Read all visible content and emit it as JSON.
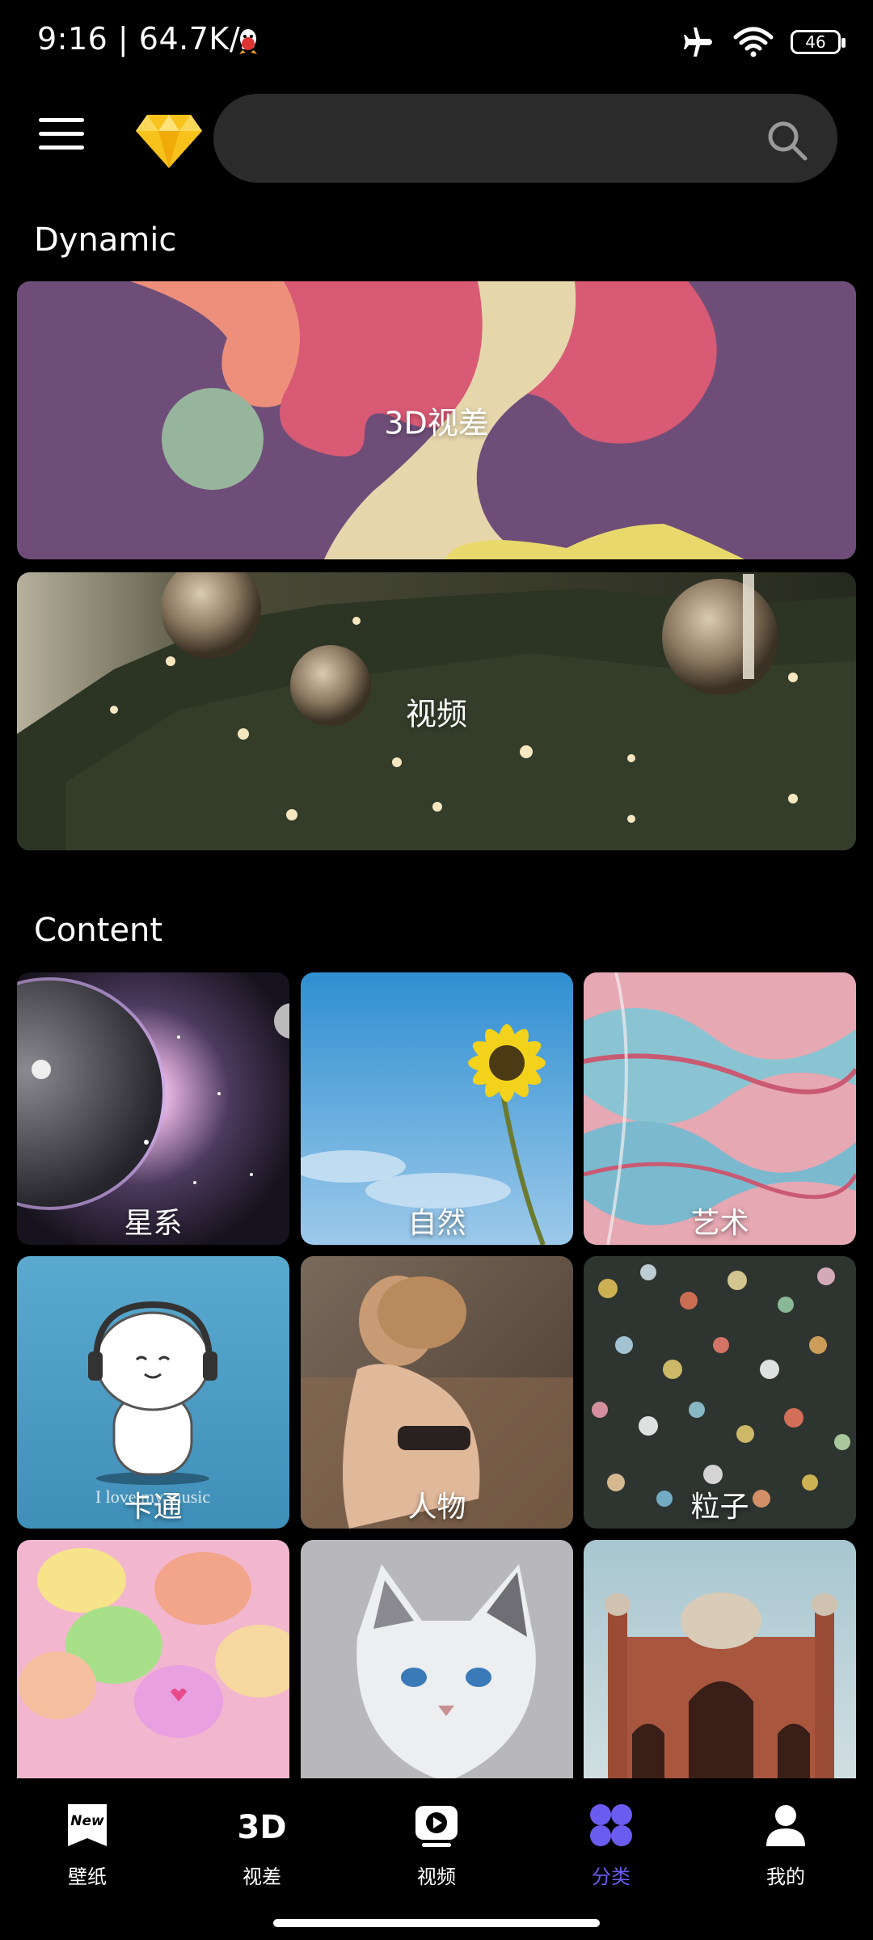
{
  "status_bar": {
    "time": "9:16 | 64.7K/s",
    "battery": "46"
  },
  "search": {
    "placeholder": ""
  },
  "sections": {
    "dynamic_title": "Dynamic",
    "content_title": "Content"
  },
  "dynamic_cards": [
    {
      "label": "3D视差"
    },
    {
      "label": "视频"
    }
  ],
  "content_tiles": [
    {
      "label": "星系"
    },
    {
      "label": "自然"
    },
    {
      "label": "艺术"
    },
    {
      "label": "卡通"
    },
    {
      "label": "人物"
    },
    {
      "label": "粒子"
    },
    {
      "label": ""
    },
    {
      "label": ""
    },
    {
      "label": ""
    }
  ],
  "cartoon_caption": "I love my music",
  "bottom_nav": [
    {
      "label": "壁纸",
      "icon": "new-icon"
    },
    {
      "label": "视差",
      "icon": "3d-icon"
    },
    {
      "label": "视频",
      "icon": "video-play-icon"
    },
    {
      "label": "分类",
      "icon": "category-grid-icon"
    },
    {
      "label": "我的",
      "icon": "person-icon"
    }
  ],
  "colors": {
    "accent": "#6b5cf0",
    "background": "#000000",
    "search_bg": "#2b2b2b",
    "vip_gold": "#f7c21c"
  }
}
